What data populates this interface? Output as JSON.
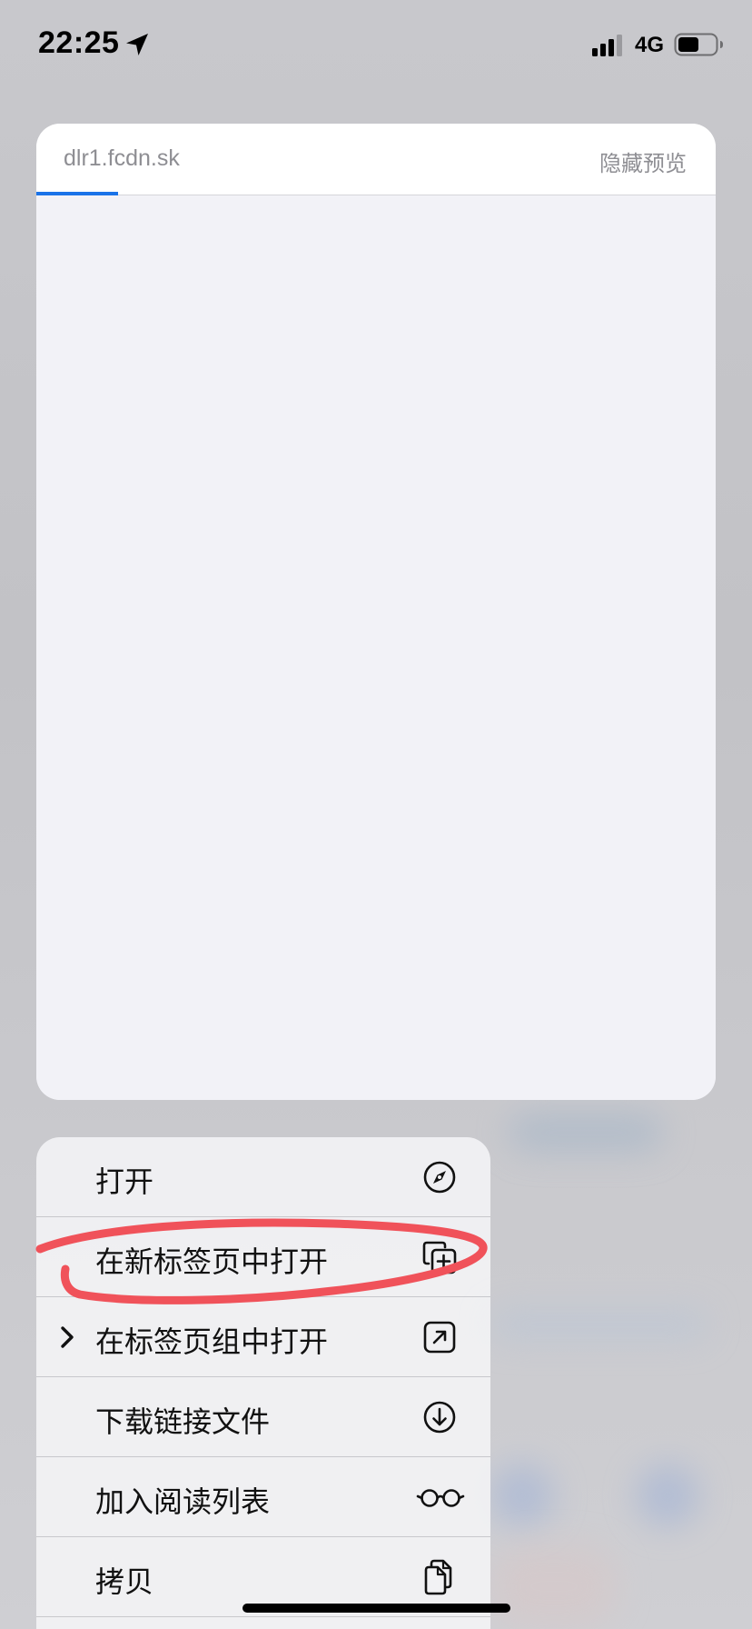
{
  "status_bar": {
    "time": "22:25",
    "network": "4G",
    "icons": [
      "location-arrow-icon",
      "cellular-signal-icon",
      "battery-icon"
    ]
  },
  "preview": {
    "url": "dlr1.fcdn.sk",
    "hide_label": "隐藏预览",
    "load_progress": 0.12
  },
  "menu": {
    "items": [
      {
        "label": "打开",
        "icon": "compass-icon",
        "has_submenu": false
      },
      {
        "label": "在新标签页中打开",
        "icon": "plus-square-on-square-icon",
        "has_submenu": false
      },
      {
        "label": "在标签页组中打开",
        "icon": "arrow-up-right-square-icon",
        "has_submenu": true
      },
      {
        "label": "下载链接文件",
        "icon": "arrow-down-circle-icon",
        "has_submenu": false
      },
      {
        "label": "加入阅读列表",
        "icon": "eyeglasses-icon",
        "has_submenu": false
      },
      {
        "label": "拷贝",
        "icon": "doc-on-doc-icon",
        "has_submenu": false
      }
    ]
  },
  "colors": {
    "accent": "#1a73e8",
    "annotation": "#f0525a",
    "secondary_text": "#8e8e93"
  }
}
